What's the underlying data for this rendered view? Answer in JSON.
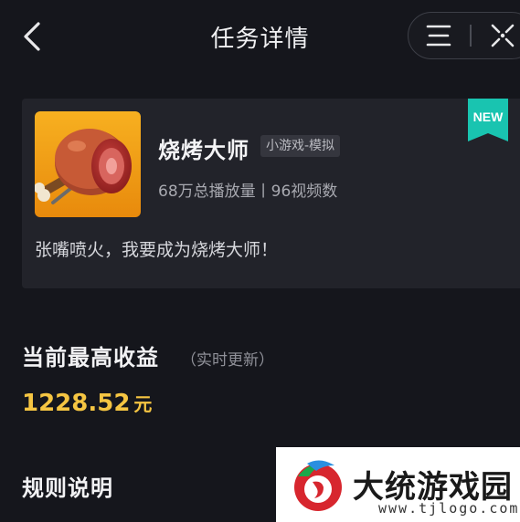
{
  "header": {
    "title": "任务详情",
    "back_icon": "chevron-left-icon",
    "menu_icon": "menu-icon",
    "close_icon": "close-target-icon"
  },
  "game": {
    "name": "烧烤大师",
    "tag": "小游戏-模拟",
    "stats": "68万总播放量丨96视频数",
    "description": "张嘴喷火，我要成为烧烤大师！",
    "badge": "NEW",
    "icon": "roast-ham-icon"
  },
  "earnings": {
    "title": "当前最高收益",
    "note": "（实时更新）",
    "amount": "1228.52",
    "unit": "元"
  },
  "rules": {
    "title": "规则说明"
  },
  "watermark": {
    "title": "大统游戏园",
    "url": "www.tjlogo.com",
    "logo_icon": "site-logo-icon"
  },
  "colors": {
    "background": "#15161c",
    "card": "#22232a",
    "accent_gold": "#f5c542",
    "badge_teal": "#19c4b0"
  }
}
